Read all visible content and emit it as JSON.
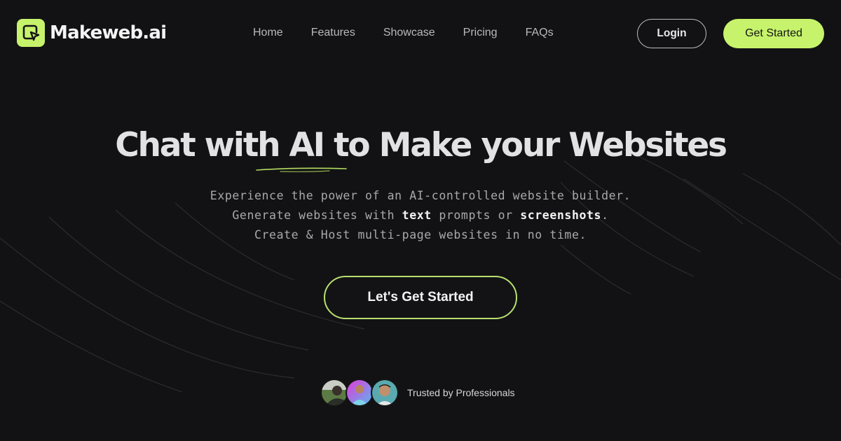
{
  "brand": {
    "name": "Makeweb.ai",
    "logo_icon": "cursor-in-frame-icon",
    "accent_color": "#c6f36b",
    "background_color": "#121214"
  },
  "nav": {
    "items": [
      {
        "label": "Home"
      },
      {
        "label": "Features"
      },
      {
        "label": "Showcase"
      },
      {
        "label": "Pricing"
      },
      {
        "label": "FAQs"
      }
    ],
    "login_label": "Login",
    "get_started_label": "Get Started"
  },
  "hero": {
    "title": "Chat with AI to Make your Websites",
    "subtitle_lines": {
      "line1": "Experience the power of an AI-controlled website builder.",
      "line2_prefix": "Generate websites with ",
      "line2_bold1": "text",
      "line2_mid": " prompts or ",
      "line2_bold2": "screenshots",
      "line2_suffix": ".",
      "line3": "Create & Host multi-page websites in no time."
    },
    "cta_label": "Let's Get Started"
  },
  "trust": {
    "avatars": [
      {
        "name": "professional-avatar-1"
      },
      {
        "name": "professional-avatar-2"
      },
      {
        "name": "professional-avatar-3"
      }
    ],
    "label": "Trusted by Professionals"
  }
}
